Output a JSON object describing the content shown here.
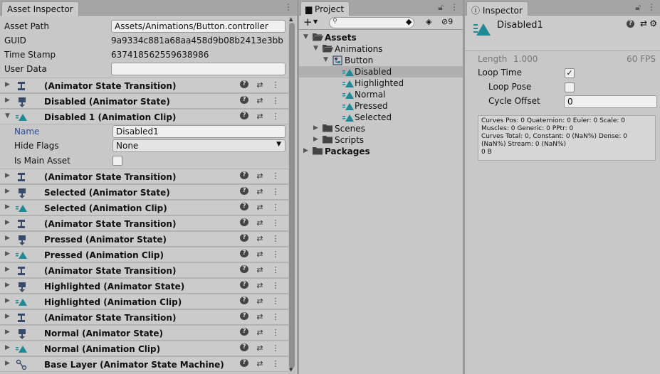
{
  "asset_inspector": {
    "tab": "Asset Inspector",
    "props": [
      {
        "label": "Asset Path",
        "value": "Assets/Animations/Button.controller",
        "kind": "field"
      },
      {
        "label": "GUID",
        "value": "9a9334c881a68aa458d9b08b2413e3bb",
        "kind": "text"
      },
      {
        "label": "Time Stamp",
        "value": "637418562559638986",
        "kind": "text"
      },
      {
        "label": "User Data",
        "value": "",
        "kind": "field"
      }
    ],
    "sub": {
      "name_label": "Name",
      "name_value": "Disabled1",
      "hide_label": "Hide Flags",
      "hide_value": "None",
      "main_label": "Is Main Asset"
    },
    "headers": [
      {
        "title": " (Animator State Transition)",
        "icon": "transition-icon",
        "open": false
      },
      {
        "title": "Disabled (Animator State)",
        "icon": "state-icon",
        "open": false
      },
      {
        "title": "Disabled 1 (Animation Clip)",
        "icon": "clip-icon",
        "open": true
      },
      {
        "title": " (Animator State Transition)",
        "icon": "transition-icon",
        "open": false
      },
      {
        "title": "Selected (Animator State)",
        "icon": "state-icon",
        "open": false
      },
      {
        "title": "Selected (Animation Clip)",
        "icon": "clip-icon",
        "open": false
      },
      {
        "title": " (Animator State Transition)",
        "icon": "transition-icon",
        "open": false
      },
      {
        "title": "Pressed (Animator State)",
        "icon": "state-icon",
        "open": false
      },
      {
        "title": "Pressed (Animation Clip)",
        "icon": "clip-icon",
        "open": false
      },
      {
        "title": " (Animator State Transition)",
        "icon": "transition-icon",
        "open": false
      },
      {
        "title": "Highlighted (Animator State)",
        "icon": "state-icon",
        "open": false
      },
      {
        "title": "Highlighted (Animation Clip)",
        "icon": "clip-icon",
        "open": false
      },
      {
        "title": " (Animator State Transition)",
        "icon": "transition-icon",
        "open": false
      },
      {
        "title": "Normal (Animator State)",
        "icon": "state-icon",
        "open": false
      },
      {
        "title": "Normal (Animation Clip)",
        "icon": "clip-icon",
        "open": false
      },
      {
        "title": "Base Layer (Animator State Machine)",
        "icon": "state-machine-icon",
        "open": false
      }
    ]
  },
  "project": {
    "tab": "Project",
    "hidden_count": "9",
    "tree": [
      {
        "label": "Assets",
        "bold": true,
        "icon": "folder-open-icon",
        "depth": 0,
        "fold": "▼"
      },
      {
        "label": "Animations",
        "bold": false,
        "icon": "folder-open-icon",
        "depth": 1,
        "fold": "▼"
      },
      {
        "label": "Button",
        "bold": false,
        "icon": "animator-controller-icon",
        "depth": 2,
        "fold": "▼"
      },
      {
        "label": "Disabled",
        "bold": false,
        "icon": "clip-icon",
        "depth": 3,
        "fold": "",
        "selected": true
      },
      {
        "label": "Highlighted",
        "bold": false,
        "icon": "clip-icon",
        "depth": 3,
        "fold": ""
      },
      {
        "label": "Normal",
        "bold": false,
        "icon": "clip-icon",
        "depth": 3,
        "fold": ""
      },
      {
        "label": "Pressed",
        "bold": false,
        "icon": "clip-icon",
        "depth": 3,
        "fold": ""
      },
      {
        "label": "Selected",
        "bold": false,
        "icon": "clip-icon",
        "depth": 3,
        "fold": ""
      },
      {
        "label": "Scenes",
        "bold": false,
        "icon": "folder-icon",
        "depth": 1,
        "fold": "▶"
      },
      {
        "label": "Scripts",
        "bold": false,
        "icon": "folder-icon",
        "depth": 1,
        "fold": "▶"
      },
      {
        "label": "Packages",
        "bold": true,
        "icon": "folder-icon",
        "depth": 0,
        "fold": "▶"
      }
    ]
  },
  "inspector": {
    "tab": "Inspector",
    "title": "Disabled1",
    "length_label": "Length",
    "length_value": "1.000",
    "fps": "60 FPS",
    "loop_time": "Loop Time",
    "loop_pose": "Loop Pose",
    "cycle_offset": "Cycle Offset",
    "cycle_value": "0",
    "info_lines": [
      "Curves Pos: 0 Quaternion: 0 Euler: 0 Scale: 0",
      "Muscles: 0 Generic: 0 PPtr: 0",
      "Curves Total: 0, Constant: 0 (NaN%) Dense: 0",
      "(NaN%) Stream: 0 (NaN%)",
      "0 B"
    ]
  },
  "colors": {
    "clip": "#1f8a94",
    "state": "#3a4a6a"
  }
}
